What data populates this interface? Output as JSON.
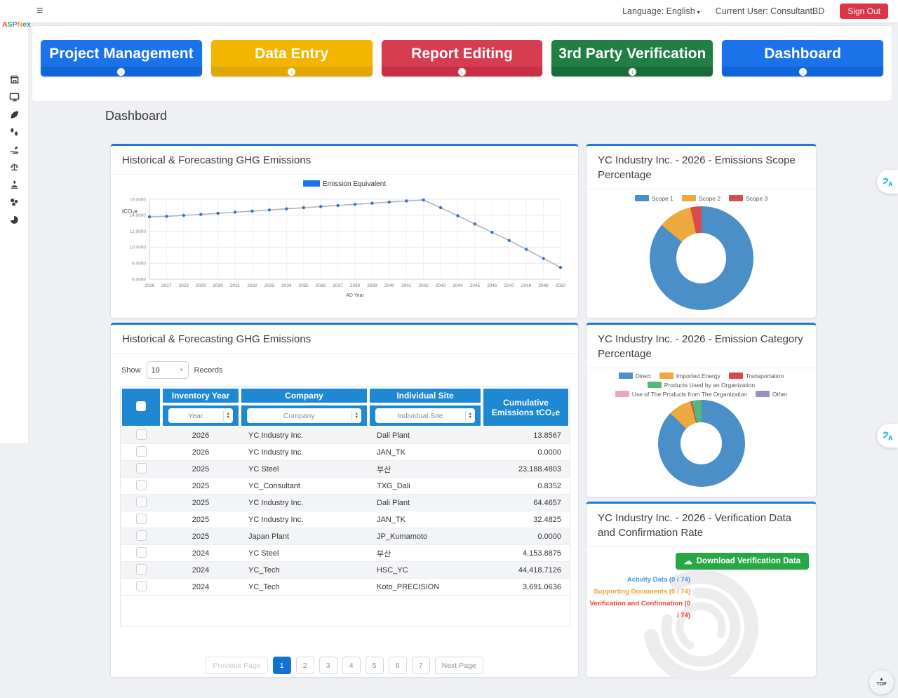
{
  "topbar": {
    "hamburger": "≡",
    "language": "Language: English",
    "caret": "▾",
    "current_user": "Current User: ConsultantBD",
    "sign_out": "Sign Out"
  },
  "logo": {
    "text": "ASPNex",
    "letters": [
      {
        "ch": "A",
        "color": "#ea4335"
      },
      {
        "ch": "S",
        "color": "#34a853"
      },
      {
        "ch": "P",
        "color": "#4285f4"
      },
      {
        "ch": "N",
        "color": "#f59e0b"
      },
      {
        "ch": "e",
        "color": "#34a853"
      },
      {
        "ch": "x",
        "color": "#4285f4"
      }
    ]
  },
  "nav_buttons": [
    {
      "label": "Project Management",
      "bg": "#1a73e8",
      "footer": "#1265d8"
    },
    {
      "label": "Data Entry",
      "bg": "#f2b600",
      "footer": "#e0a800"
    },
    {
      "label": "Report Editing",
      "bg": "#d63d51",
      "footer": "#c62f44"
    },
    {
      "label": "3rd Party Verification",
      "bg": "#217e45",
      "footer": "#196b39"
    },
    {
      "label": "Dashboard",
      "bg": "#1a73e8",
      "footer": "#1265d8"
    }
  ],
  "sidebar": {
    "icons": [
      "building-icon",
      "monitor-icon",
      "leaf-icon",
      "footprints-icon",
      "hand-holding-plant-icon",
      "scale-icon",
      "stamp-icon",
      "coins-icon",
      "pie-chart-icon"
    ]
  },
  "page_title": "Dashboard",
  "chart_data": [
    {
      "type": "line",
      "title": "Historical & Forecasting GHG Emissions",
      "unit_label": "tCO₂e",
      "xlabel": "AD Year",
      "legend_items": [
        {
          "label": "Emission Equivalent",
          "color": "#1a73e8"
        }
      ],
      "x": [
        2026,
        2027,
        2028,
        2029,
        2030,
        2031,
        2032,
        2033,
        2034,
        2035,
        2036,
        2037,
        2038,
        2039,
        2040,
        2041,
        2042,
        2043,
        2044,
        2045,
        2046,
        2047,
        2048,
        2049,
        2050
      ],
      "values": [
        13.8,
        13.86,
        13.98,
        14.1,
        14.24,
        14.38,
        14.52,
        14.66,
        14.8,
        14.94,
        15.08,
        15.22,
        15.36,
        15.5,
        15.64,
        15.78,
        15.9,
        14.95,
        13.93,
        12.9,
        11.87,
        10.84,
        9.73,
        8.6,
        7.47
      ],
      "ylim": [
        6,
        16
      ],
      "ytick_step": 2,
      "grid": true,
      "legend_position": "top",
      "line_color": "#b3b3b3",
      "point_color": "#3473bd"
    },
    {
      "type": "pie",
      "subtype": "doughnut",
      "title": "YC Industry Inc. - 2026 - Emissions Scope Percentage",
      "labels": [
        "Scope 1",
        "Scope 2",
        "Scope 3"
      ],
      "values": [
        86,
        10.5,
        3.5
      ],
      "colors": [
        "#4a8fc7",
        "#ecaa3e",
        "#d94a4a"
      ],
      "legend_position": "top"
    },
    {
      "type": "pie",
      "subtype": "doughnut",
      "title": "YC Industry Inc. - 2026 - Emission Category Percentage",
      "labels": [
        "Direct",
        "Imported Energy",
        "Transportation",
        "Products Used by an Organization",
        "Use of The Products from The Organization",
        "Other"
      ],
      "values": [
        87.2,
        8.6,
        0.7,
        3.5,
        0,
        0
      ],
      "colors": [
        "#4a8fc7",
        "#ecaa3e",
        "#d94a4a",
        "#53b87d",
        "#f0a6b8",
        "#988fc4"
      ],
      "legend_position": "top"
    },
    {
      "type": "progress-rings",
      "title": "YC Industry Inc. - 2026 - Verification Data and Confirmation Rate",
      "series": [
        {
          "name": "Activity Data",
          "done": 0,
          "total": 74,
          "color": "#3d9be9"
        },
        {
          "name": "Supporting Documents",
          "done": 0,
          "total": 74,
          "color": "#f0a030"
        },
        {
          "name": "Verification and Confirmation",
          "done": 0,
          "total": 74,
          "color": "#ef4135"
        }
      ],
      "labels_display": [
        "Activity Data (0 / 74)",
        "Supporting Documents (0 / 74)",
        "Verification and Confirmation (0 / 74)"
      ]
    }
  ],
  "table_card": {
    "title": "Historical & Forecasting GHG Emissions",
    "show_label": "Show",
    "page_size": "10",
    "records_label": "Records",
    "columns": [
      "Inventory Year",
      "Company",
      "Individual Site",
      "Cumulative Emissions tCO₂e"
    ],
    "filters": [
      "Year",
      "Company",
      "Individual Site"
    ],
    "rows": [
      [
        "2026",
        "YC Industry Inc.",
        "Dali Plant",
        "13.8567"
      ],
      [
        "2026",
        "YC Industry Inc.",
        "JAN_TK",
        "0.0000"
      ],
      [
        "2025",
        "YC Steel",
        "부산",
        "23,188.4803"
      ],
      [
        "2025",
        "YC_Consultant",
        "TXG_Dali",
        "0.8352"
      ],
      [
        "2025",
        "YC Industry Inc.",
        "Dali Plant",
        "64.4657"
      ],
      [
        "2025",
        "YC Industry Inc.",
        "JAN_TK",
        "32.4825"
      ],
      [
        "2025",
        "Japan Plant",
        "JP_Kumamoto",
        "0.0000"
      ],
      [
        "2024",
        "YC Steel",
        "부산",
        "4,153.8875"
      ],
      [
        "2024",
        "YC_Tech",
        "HSC_YC",
        "44,418.7126"
      ],
      [
        "2024",
        "YC_Tech",
        "Koto_PRECISION",
        "3,691.0636"
      ]
    ],
    "pagination": {
      "prev": "Previous Page",
      "pages": [
        "1",
        "2",
        "3",
        "4",
        "5",
        "6",
        "7"
      ],
      "active": "1",
      "next": "Next Page"
    }
  },
  "verification": {
    "download_button": "Download Verification Data"
  },
  "floating": {
    "top_button": "TOP"
  }
}
